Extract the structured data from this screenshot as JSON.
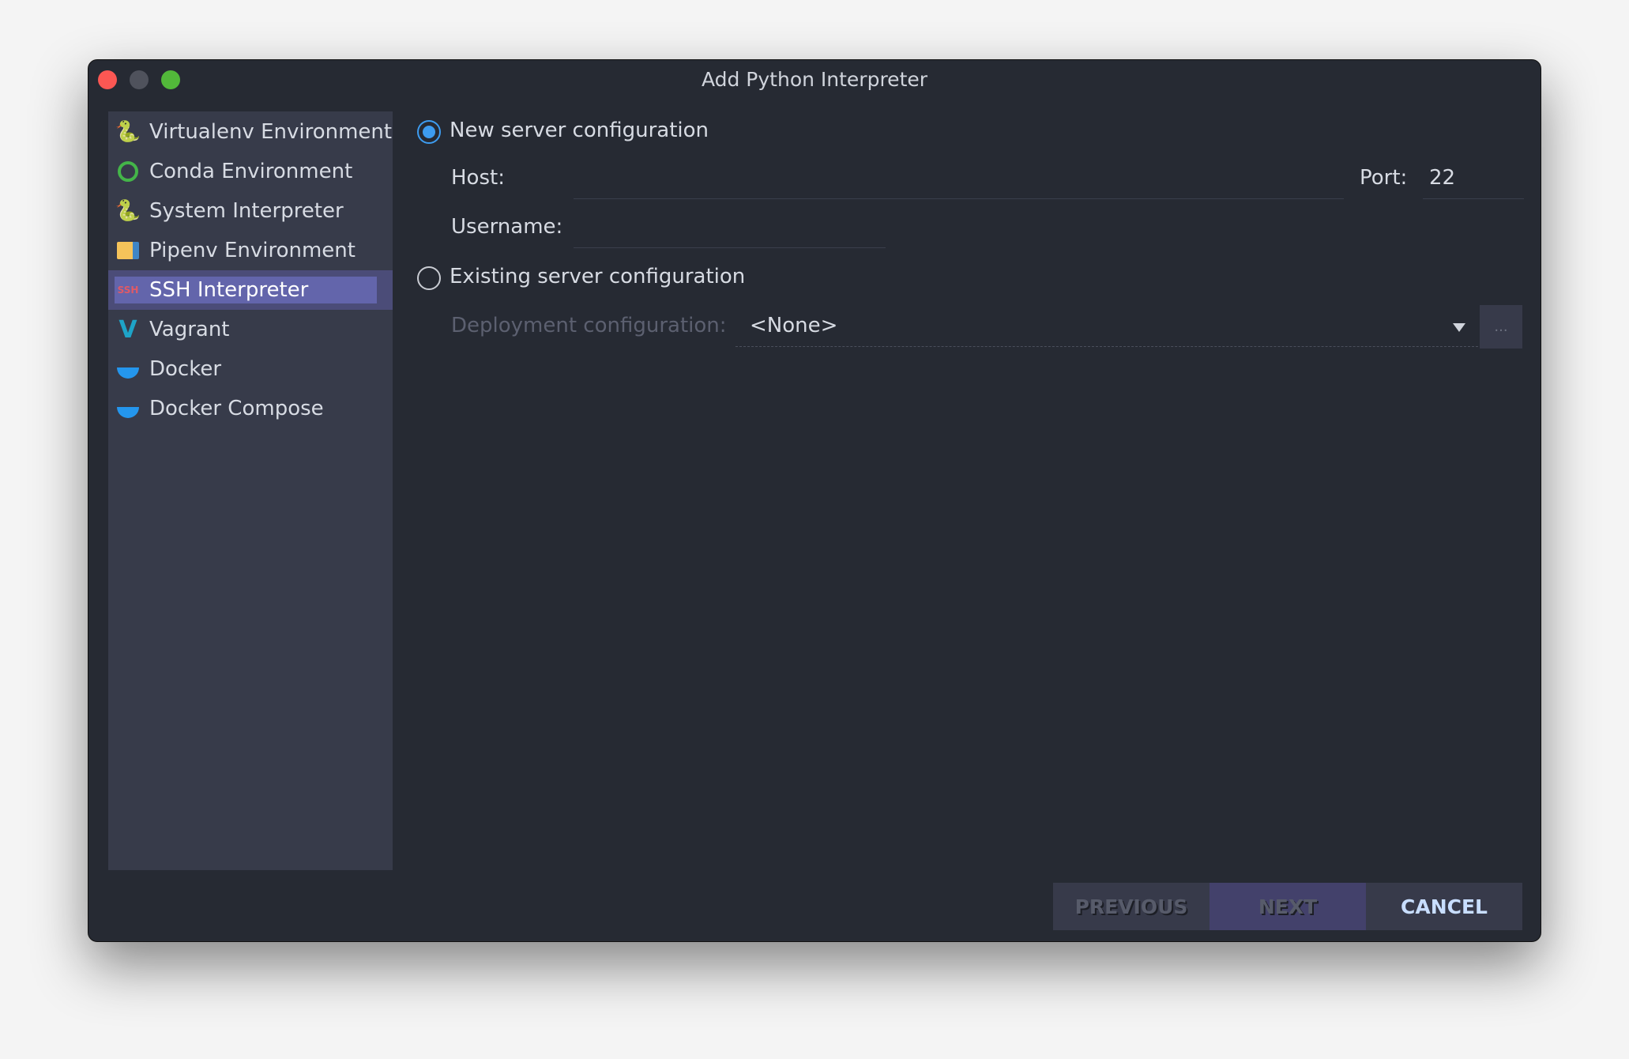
{
  "window": {
    "title": "Add Python Interpreter"
  },
  "sidebar": {
    "items": [
      {
        "label": "Virtualenv Environment",
        "icon": "python-virtualenv-icon"
      },
      {
        "label": "Conda Environment",
        "icon": "conda-icon"
      },
      {
        "label": "System Interpreter",
        "icon": "python-icon"
      },
      {
        "label": "Pipenv Environment",
        "icon": "pipenv-folder-icon"
      },
      {
        "label": "SSH Interpreter",
        "icon": "ssh-icon",
        "selected": true
      },
      {
        "label": "Vagrant",
        "icon": "vagrant-icon"
      },
      {
        "label": "Docker",
        "icon": "docker-icon"
      },
      {
        "label": "Docker Compose",
        "icon": "docker-compose-icon"
      }
    ]
  },
  "form": {
    "new_server": "New server configuration",
    "host_label": "Host:",
    "host_value": "",
    "port_label": "Port:",
    "port_value": "22",
    "username_label": "Username:",
    "username_value": "",
    "existing_server": "Existing server configuration",
    "deployment_label": "Deployment configuration:",
    "deployment_value": "<None>",
    "browse": "...",
    "selected_option": "new"
  },
  "buttons": {
    "previous": "PREVIOUS",
    "next": "NEXT",
    "cancel": "CANCEL"
  },
  "colors": {
    "accent": "#3d9cf0",
    "selection": "#6365ab",
    "background": "#262a33",
    "sidebar": "#373b4a"
  }
}
